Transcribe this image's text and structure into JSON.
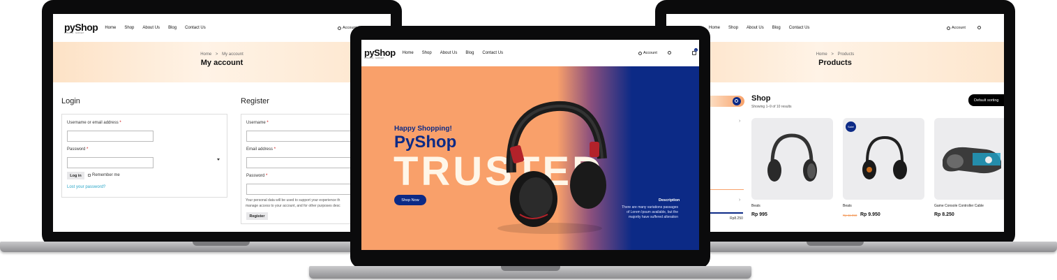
{
  "nav": {
    "logo": "pyShop",
    "logo_tagline": "FASHION · GADGET",
    "links": [
      "Home",
      "Shop",
      "About Us",
      "Blog",
      "Contact Us"
    ],
    "account": "Account",
    "cart_count": "0"
  },
  "account_page": {
    "breadcrumb_home": "Home",
    "breadcrumb_sep": ">",
    "breadcrumb_current": "My account",
    "title": "My account",
    "login": {
      "heading": "Login",
      "username_label": "Username or email address",
      "password_label": "Password",
      "login_button": "Log in",
      "remember_me": "Remember me",
      "lost_password": "Lost your password?"
    },
    "register": {
      "heading": "Register",
      "username_label": "Username",
      "email_label": "Email address",
      "password_label": "Password",
      "privacy_text": "Your personal data will be used to support your experience th",
      "privacy_text_2": "manage access to your account, and for other purposes desc",
      "register_button": "Register"
    }
  },
  "home_page": {
    "greeting": "Happy Shopping!",
    "brand": "PyShop",
    "big_word": "TRUSTED",
    "cta_button": "Shop Now",
    "description_heading": "Description",
    "description_text_1": "There are many variations passages",
    "description_text_2": "of Lorem Ipsum available, but the",
    "description_text_3": "majority have suffered alteration",
    "colors": {
      "orange": "#f9a06a",
      "navy": "#0c2a86"
    }
  },
  "products_page": {
    "breadcrumb_home": "Home",
    "breadcrumb_sep": ">",
    "breadcrumb_current": "Products",
    "title": "Products",
    "shop_heading": "Shop",
    "results": "Showing 1–9 of 10 results",
    "sorting": "Default sorting",
    "price_filter_max": "Rp8.250",
    "products": [
      {
        "name": "Beats",
        "price": "Rp 995",
        "old_price": "",
        "badge": ""
      },
      {
        "name": "Beats",
        "price": "Rp 9.950",
        "old_price": "Rp 11.950",
        "badge": "Sale!"
      },
      {
        "name": "Game Console Controller Cable",
        "price": "Rp 8.250",
        "old_price": "",
        "badge": ""
      }
    ]
  }
}
